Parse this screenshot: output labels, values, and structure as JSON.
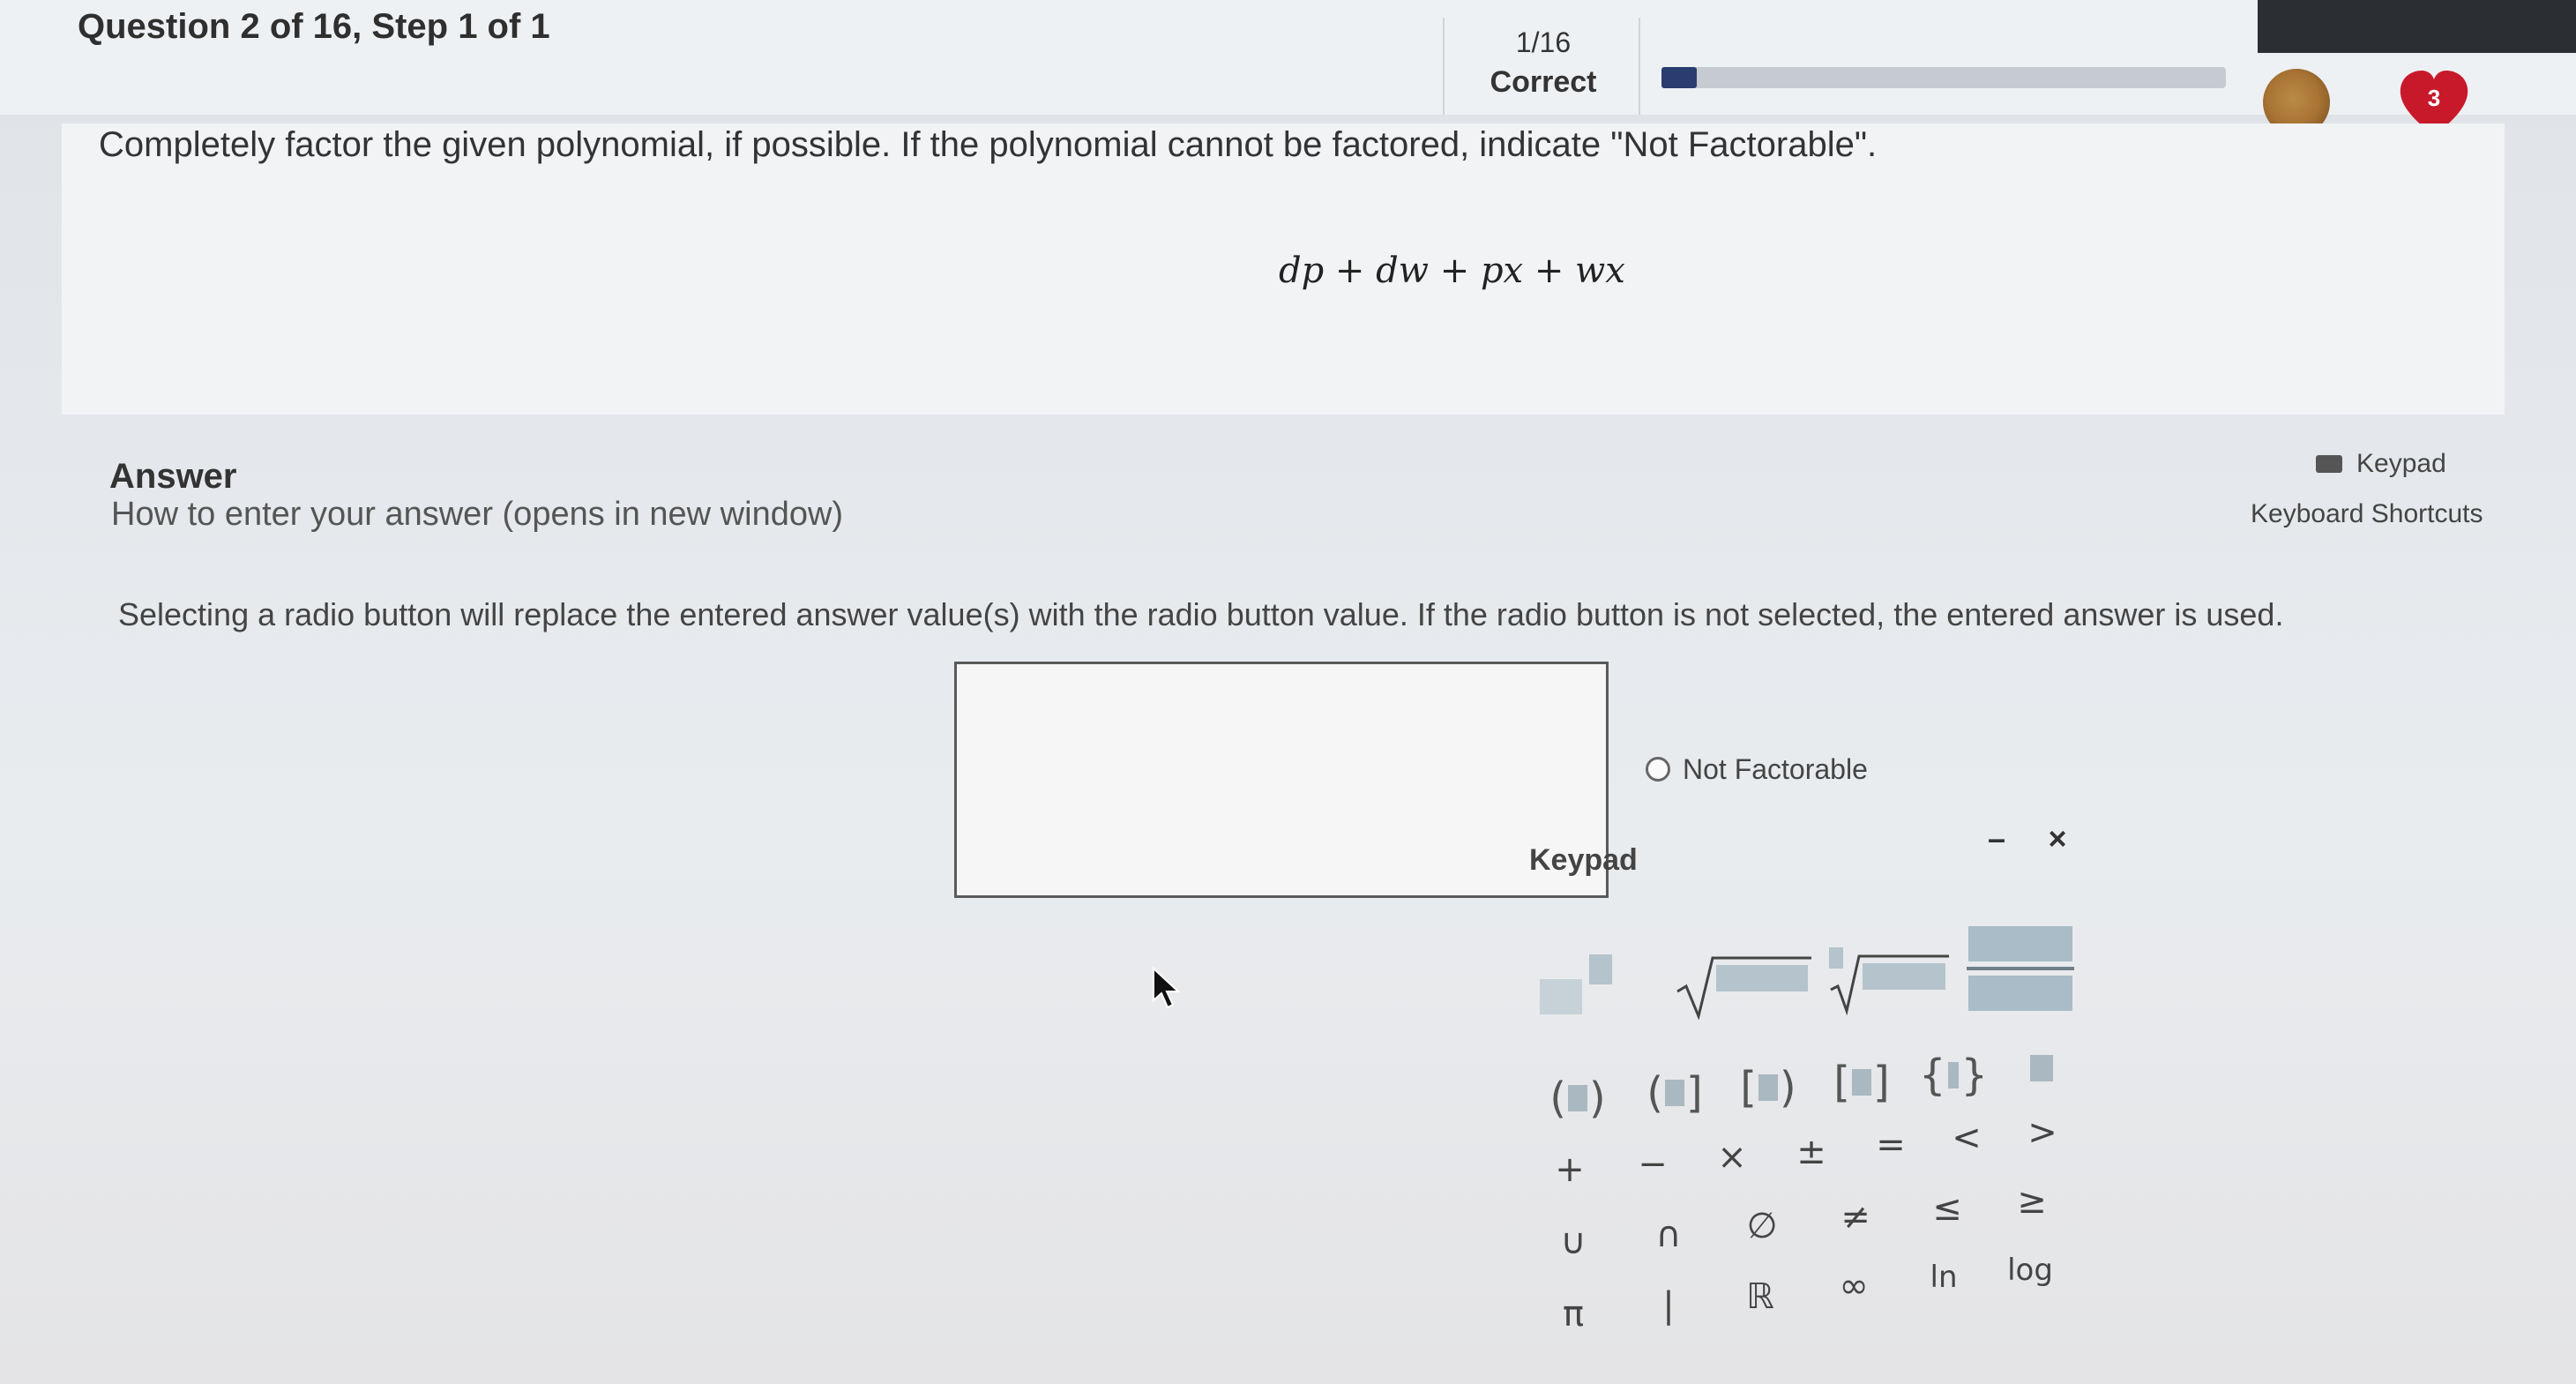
{
  "header": {
    "question_title": "Question 2 of 16, Step 1 of 1",
    "progress": {
      "count": "1/16",
      "status": "Correct",
      "fraction": 0.0625,
      "fill_color": "#2a3d70"
    },
    "hearts_count": "3",
    "heart_color": "#c8192b"
  },
  "question": {
    "prompt": "Completely factor the given polynomial, if possible. If the polynomial cannot be factored, indicate \"Not Factorable\".",
    "expression": "dp + dw + px + wx"
  },
  "answer": {
    "heading": "Answer",
    "help_link": "How to enter your answer (opens in new window)",
    "keypad_toggle_label": "Keypad",
    "keyboard_shortcuts_label": "Keyboard Shortcuts",
    "instructions": "Selecting a radio button will replace the entered answer value(s) with the radio button value. If the radio button is not selected, the entered answer is used.",
    "input_value": "",
    "not_factorable_label": "Not Factorable",
    "not_factorable_selected": false
  },
  "keypad": {
    "title": "Keypad",
    "minimize_label": "–",
    "close_label": "×",
    "operators": [
      "+",
      "−",
      "×",
      "±",
      "=",
      "<",
      ">"
    ],
    "sets": [
      "∪",
      "∩",
      "∅",
      "≠",
      "≤",
      "≥"
    ],
    "constants": [
      "π",
      "|",
      "ℝ",
      "∞",
      "ln",
      "log"
    ]
  }
}
